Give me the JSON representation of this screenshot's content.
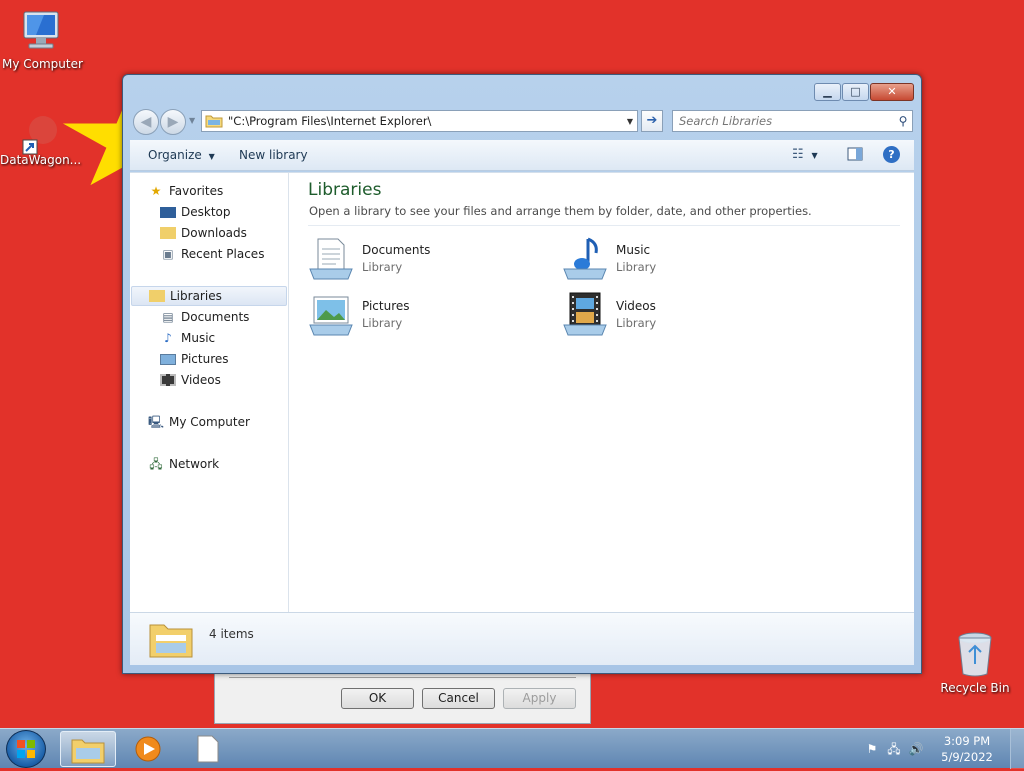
{
  "desktop": {
    "icons": [
      {
        "label": "My Computer"
      },
      {
        "label": "DataWagon..."
      },
      {
        "label": "Recycle Bin"
      }
    ]
  },
  "dialog_behind": {
    "ok_label": "OK",
    "cancel_label": "Cancel",
    "apply_label": "Apply"
  },
  "explorer": {
    "address_value": "\"C:\\Program Files\\Internet Explorer\\",
    "search_placeholder": "Search Libraries",
    "toolbar": {
      "organize_label": "Organize",
      "new_library_label": "New library"
    },
    "nav": {
      "favorites": "Favorites",
      "desktop": "Desktop",
      "downloads": "Downloads",
      "recent_places": "Recent Places",
      "libraries": "Libraries",
      "documents": "Documents",
      "music": "Music",
      "pictures": "Pictures",
      "videos": "Videos",
      "my_computer": "My Computer",
      "network": "Network"
    },
    "main": {
      "title": "Libraries",
      "description": "Open a library to see your files and arrange them by folder, date, and other properties.",
      "items": [
        {
          "name": "Documents",
          "type": "Library"
        },
        {
          "name": "Music",
          "type": "Library"
        },
        {
          "name": "Pictures",
          "type": "Library"
        },
        {
          "name": "Videos",
          "type": "Library"
        }
      ]
    },
    "status": {
      "count": "4 items"
    }
  },
  "taskbar": {
    "time": "3:09 PM",
    "date": "5/9/2022"
  },
  "colors": {
    "desktop_bg": "#e2322a",
    "star": "#ffde00",
    "library_title": "#1e5c2c"
  }
}
